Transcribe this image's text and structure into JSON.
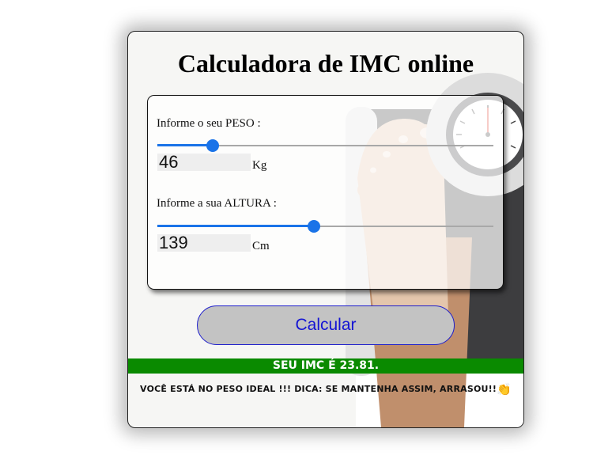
{
  "title": "Calculadora de IMC online",
  "form": {
    "weight": {
      "label": "Informe o seu PESO :",
      "value": "46",
      "unit": "Kg",
      "slider_fraction": 0.165
    },
    "height": {
      "label": "Informe a sua ALTURA :",
      "value": "139",
      "unit": "Cm",
      "slider_fraction": 0.465
    }
  },
  "calculate_label": "Calcular",
  "result": {
    "text": "SEU IMC É 23.81."
  },
  "message": {
    "text": "VOCÊ ESTÁ NO PESO IDEAL !!! DICA: SE MANTENHA ASSIM, ARRASOU!!",
    "emoji": "👏"
  },
  "colors": {
    "accent": "#1a73e8",
    "result_bg": "#0a8a00",
    "button_bg": "#c3c3c3",
    "button_text": "#1414d4"
  }
}
